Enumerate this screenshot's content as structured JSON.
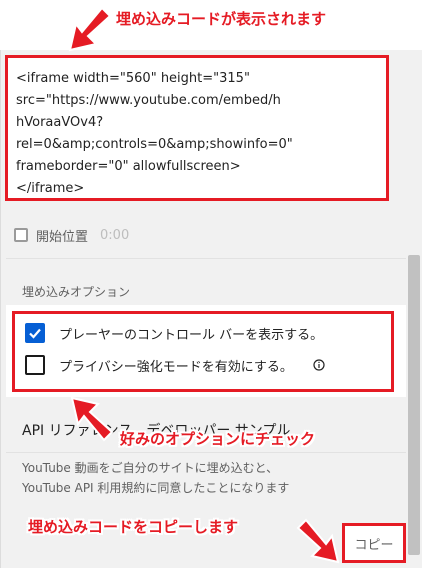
{
  "embed_code": {
    "lines": [
      "<iframe width=\"560\" height=\"315\"",
      "src=\"https://www.youtube.com/embed/h",
      "hVoraaVOv4?",
      "rel=0&amp;controls=0&amp;showinfo=0\"",
      "frameborder=\"0\" allowfullscreen>",
      "</iframe>"
    ]
  },
  "start_position": {
    "label": "開始位置",
    "time": "0:00",
    "checked": false
  },
  "embed_options": {
    "heading": "埋め込みオプション",
    "items": [
      {
        "label": "プレーヤーのコントロール バーを表示する。",
        "checked": true
      },
      {
        "label": "プライバシー強化モードを有効にする。",
        "checked": false,
        "icon": "info-icon"
      }
    ]
  },
  "api_links": {
    "text": "API リファレンス　デベロッパー サンプル"
  },
  "terms": {
    "line1": "YouTube 動画をご自分のサイトに埋め込むと、",
    "line2": "YouTube API 利用規約に同意したことになります"
  },
  "copy_button": {
    "label": "コピー"
  },
  "annotations": {
    "top": "埋め込みコードが表示されます",
    "middle": "好みのオプションにチェック",
    "bottom": "埋め込みコードをコピーします"
  },
  "colors": {
    "annotation_red": "#e51b24",
    "checkbox_blue": "#065fd4"
  }
}
